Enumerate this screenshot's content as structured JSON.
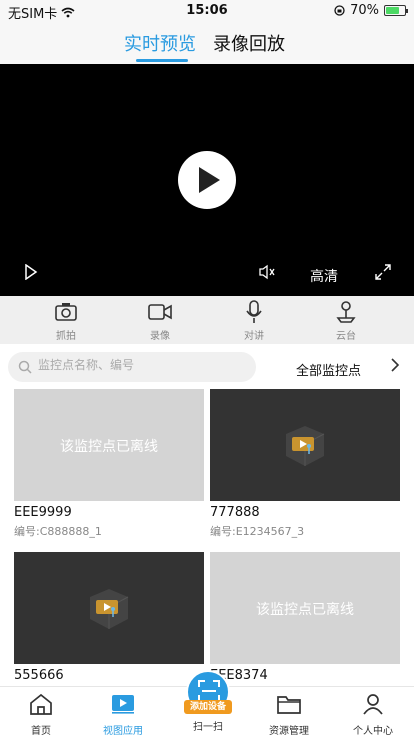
{
  "status_bar": {
    "carrier": "无SIM卡",
    "time": "15:06",
    "battery": "70%"
  },
  "top_tabs": [
    {
      "label": "实时预览",
      "active": true
    },
    {
      "label": "录像回放",
      "active": false
    }
  ],
  "player": {
    "quality_label": "高清"
  },
  "toolbar": [
    {
      "label": "抓拍",
      "icon": "camera-icon"
    },
    {
      "label": "录像",
      "icon": "video-icon"
    },
    {
      "label": "对讲",
      "icon": "microphone-icon"
    },
    {
      "label": "云台",
      "icon": "ptz-icon"
    }
  ],
  "search": {
    "placeholder": "监控点名称、编号",
    "filter_label": "全部监控点"
  },
  "cameras": [
    {
      "name": "EEE9999",
      "code": "编号:C888888_1",
      "status": "offline",
      "offline_text": "该监控点已离线"
    },
    {
      "name": "777888",
      "code": "编号:E1234567_3",
      "status": "online"
    },
    {
      "name": "555666",
      "code": "",
      "status": "online"
    },
    {
      "name": "EEE8374",
      "code": "",
      "status": "offline",
      "offline_text": "该监控点已离线"
    }
  ],
  "bottom_nav": [
    {
      "label": "首页",
      "icon": "home-icon",
      "active": false
    },
    {
      "label": "视图应用",
      "icon": "play-view-icon",
      "active": true
    },
    {
      "label": "扫一扫",
      "icon": "scan-icon",
      "active": false,
      "badge": "添加设备"
    },
    {
      "label": "资源管理",
      "icon": "folder-icon",
      "active": false
    },
    {
      "label": "个人中心",
      "icon": "user-icon",
      "active": false
    }
  ],
  "colors": {
    "accent": "#2a9be0",
    "badge": "#f09a1f",
    "offline_bg": "#d4d4d4",
    "online_bg": "#333333"
  }
}
